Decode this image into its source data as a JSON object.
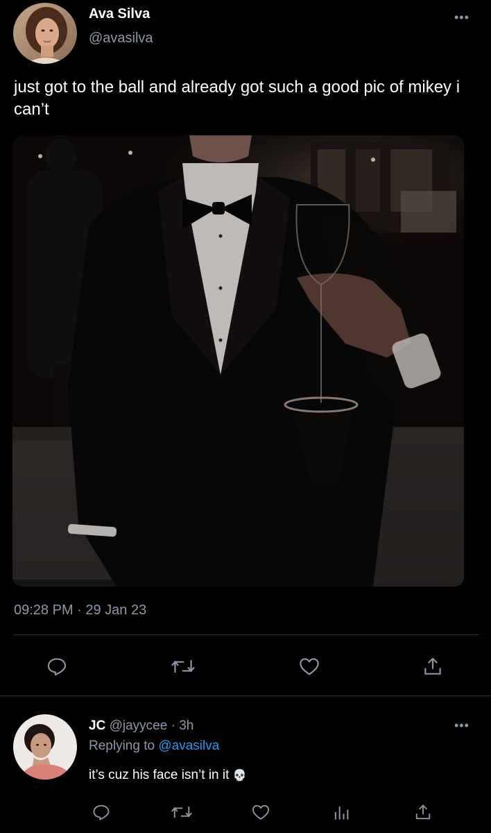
{
  "main_tweet": {
    "display_name": "Ava Silva",
    "handle": "@avasilva",
    "text": "just got to the ball and already got such a good pic of mikey i can’t",
    "timestamp": "09:28 PM · 29 Jan 23",
    "avatar_icon": "user-avatar",
    "more_icon": "more-icon"
  },
  "actions": {
    "reply_icon": "reply-icon",
    "retweet_icon": "retweet-icon",
    "like_icon": "heart-icon",
    "share_icon": "share-icon"
  },
  "reply": {
    "display_name": "JC",
    "handle": "@jayycee",
    "separator": " · ",
    "time": "3h",
    "replying_prefix": "Replying to ",
    "replying_to": "@avasilva",
    "text": "it’s cuz his face isn’t in it",
    "emoji": "💀",
    "avatar_icon": "user-avatar",
    "more_icon": "more-icon"
  },
  "colors": {
    "background": "#000000",
    "primary_text": "#ffffff",
    "secondary_text": "#8b98a5",
    "accent": "#1d9bf0",
    "divider": "#2f3336"
  }
}
